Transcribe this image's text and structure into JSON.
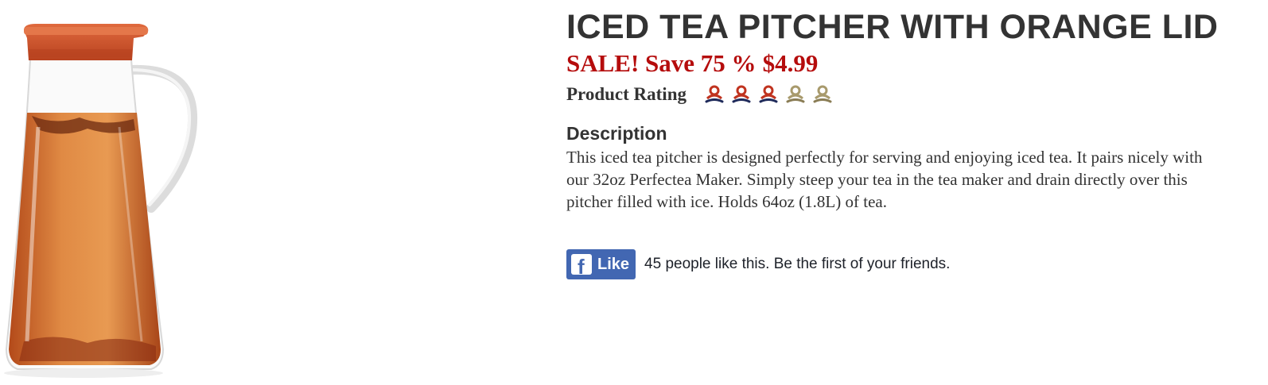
{
  "product": {
    "title": "ICED TEA PITCHER WITH ORANGE LID",
    "sale_label": "SALE! Save 75 %",
    "price": "$4.99",
    "rating_label": "Product Rating",
    "rating": {
      "value": 3,
      "max": 5
    },
    "description_heading": "Description",
    "description": "This iced tea pitcher is designed perfectly for serving and enjoying iced tea. It pairs nicely with our 32oz Perfectea Maker. Simply steep your tea in the tea maker and drain directly over this pitcher filled with ice. Holds 64oz (1.8L) of tea."
  },
  "social": {
    "like_label": "Like",
    "like_text": "45 people like this. Be the first of your friends."
  },
  "icons": {
    "rating_filled": "teacup-rating-icon-filled",
    "rating_empty": "teacup-rating-icon-empty",
    "facebook": "facebook-icon"
  },
  "colors": {
    "price": "#b50c0c",
    "lid": "#d2532d",
    "tea": "#d87a3a",
    "facebook_blue": "#4267b2",
    "rating_filled": "#c0331f",
    "rating_empty": "#a89a6c"
  }
}
